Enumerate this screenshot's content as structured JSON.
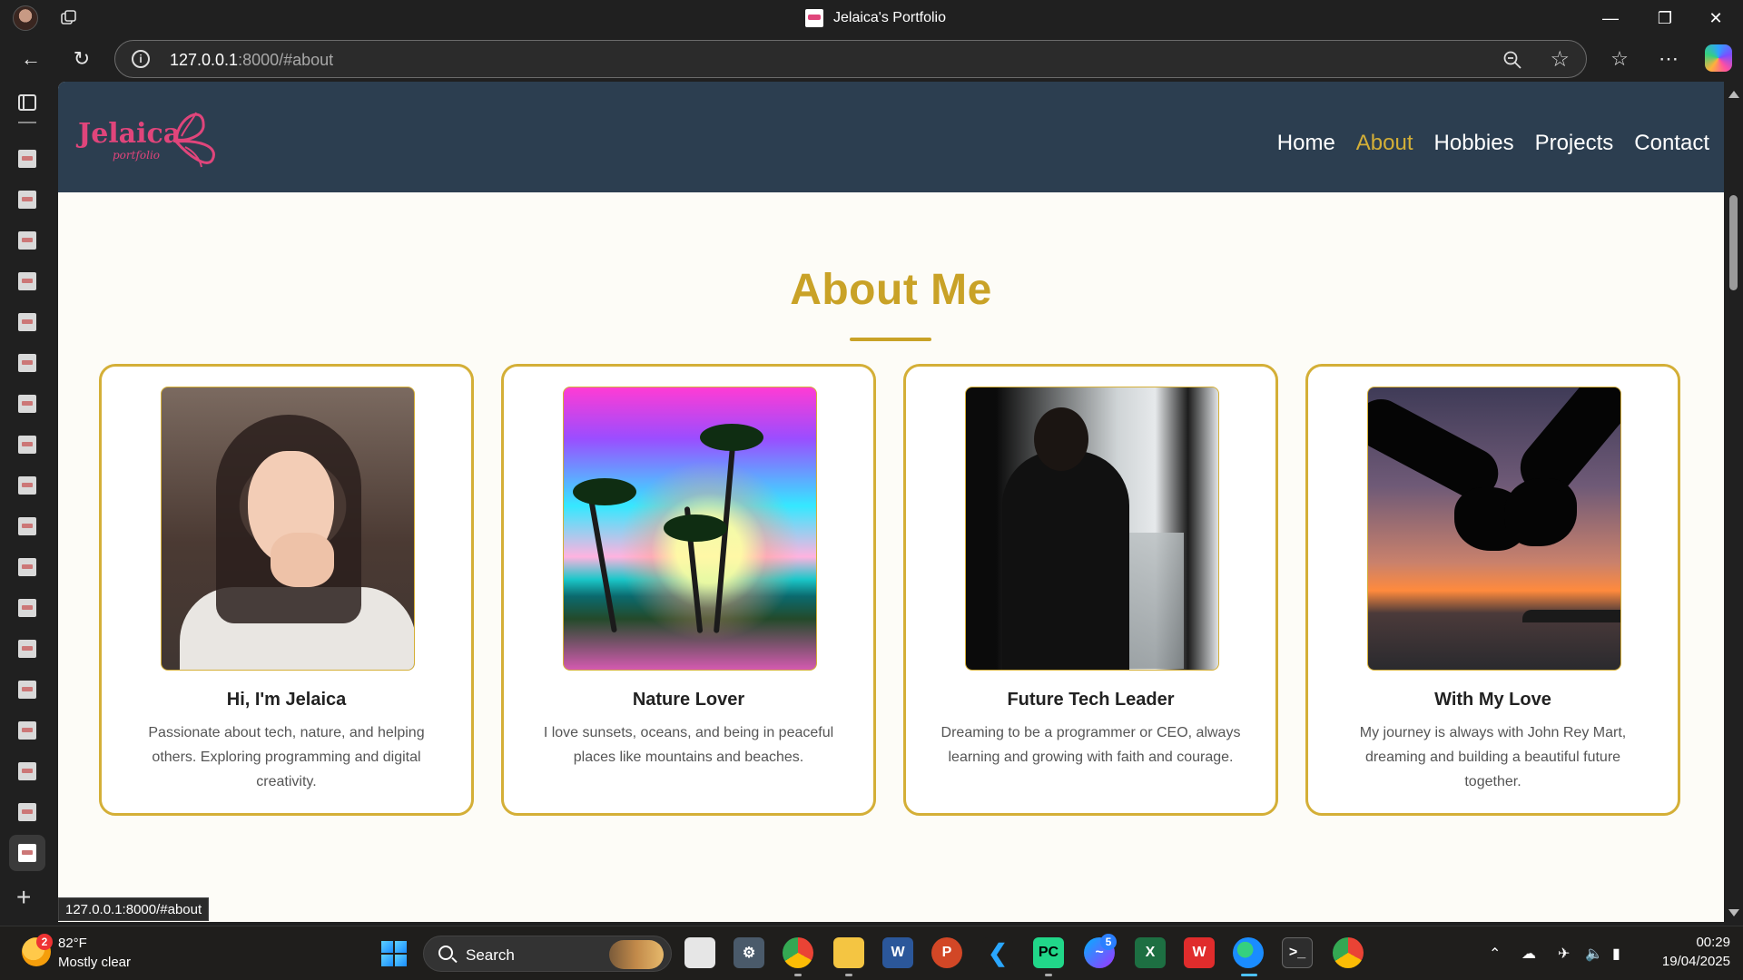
{
  "browser": {
    "window_title": "Jelaica's Portfolio",
    "url_host": "127.0.0.1",
    "url_rest": ":8000/#about",
    "status_url": "127.0.0.1:8000/#about"
  },
  "site": {
    "logo_text": "Jelaica",
    "logo_sub": "portfolio",
    "nav": [
      {
        "label": "Home"
      },
      {
        "label": "About"
      },
      {
        "label": "Hobbies"
      },
      {
        "label": "Projects"
      },
      {
        "label": "Contact"
      }
    ],
    "active_nav": "About",
    "section_title": "About Me",
    "cards": [
      {
        "title": "Hi, I'm Jelaica",
        "desc": "Passionate about tech, nature, and helping others. Exploring programming and digital creativity."
      },
      {
        "title": "Nature Lover",
        "desc": "I love sunsets, oceans, and being in peaceful places like mountains and beaches."
      },
      {
        "title": "Future Tech Leader",
        "desc": "Dreaming to be a programmer or CEO, always learning and growing with faith and courage."
      },
      {
        "title": "With My Love",
        "desc": "My journey is always with John Rey Mart, dreaming and building a beautiful future together."
      }
    ]
  },
  "colors": {
    "header_bg": "#2c3e50",
    "accent_gold": "#c9a227",
    "logo_pink": "#e0457b",
    "page_bg": "#fdfcf7"
  },
  "taskbar": {
    "weather_badge": "2",
    "weather_temp": "82°F",
    "weather_desc": "Mostly clear",
    "search_label": "Search",
    "messenger_badge": "5",
    "time": "00:29",
    "date": "19/04/2025"
  }
}
